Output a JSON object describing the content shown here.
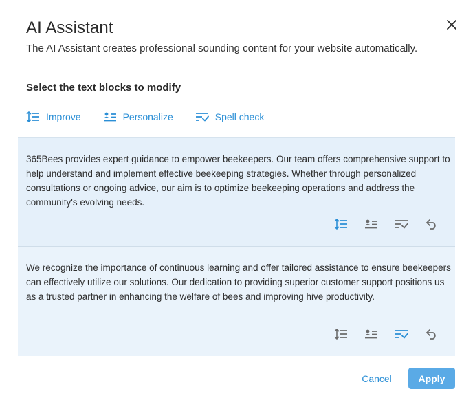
{
  "dialog": {
    "title": "AI Assistant",
    "subtitle": "The AI Assistant creates professional sounding content for your website automatically.",
    "section_label": "Select the text blocks to modify",
    "close_icon": "close-icon"
  },
  "actions": [
    {
      "label": "Improve",
      "icon": "improve-icon"
    },
    {
      "label": "Personalize",
      "icon": "personalize-icon"
    },
    {
      "label": "Spell check",
      "icon": "spell-check-icon"
    }
  ],
  "blocks": [
    {
      "text": "365Bees provides expert guidance to empower beekeepers. Our team offers comprehensive support to help understand and implement effective beekeeping strategies. Whether through personalized consultations or ongoing advice, our aim is to optimize beekeeping operations and address the community's evolving needs.",
      "active_tool": "improve"
    },
    {
      "text": "We recognize the importance of continuous learning and offer tailored assistance to ensure beekeepers can effectively utilize our solutions. Our dedication to providing superior customer support positions us as a trusted partner in enhancing the welfare of bees and improving hive productivity.",
      "active_tool": "spell-check"
    }
  ],
  "footer": {
    "cancel_label": "Cancel",
    "apply_label": "Apply"
  },
  "colors": {
    "accent": "#2b8fd6",
    "apply_button": "#5aaae6",
    "selected_block": "#e5f0fa",
    "icon_inactive": "#6b6b6b"
  }
}
